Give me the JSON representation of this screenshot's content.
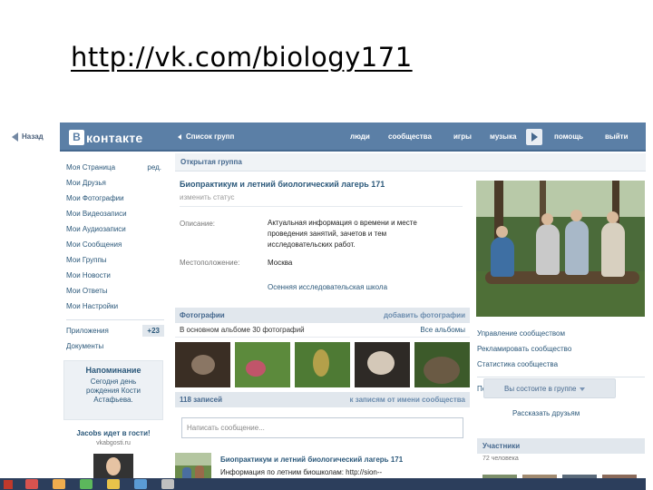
{
  "slide": {
    "title": "http://vk.com/biology171"
  },
  "back": {
    "label": "Назад"
  },
  "header": {
    "logo_letter": "В",
    "logo_text": "контакте",
    "group_list": "Список групп",
    "nav": [
      "люди",
      "сообщества",
      "игры",
      "музыка",
      "помощь",
      "выйти"
    ]
  },
  "sidebar": {
    "items": [
      {
        "label": "Моя Страница",
        "aux": "ред."
      },
      {
        "label": "Мои Друзья"
      },
      {
        "label": "Мои Фотографии"
      },
      {
        "label": "Мои Видеозаписи"
      },
      {
        "label": "Мои Аудиозаписи"
      },
      {
        "label": "Мои Сообщения"
      },
      {
        "label": "Мои Группы"
      },
      {
        "label": "Мои Новости"
      },
      {
        "label": "Мои Ответы"
      },
      {
        "label": "Мои Настройки"
      }
    ],
    "apps": {
      "label": "Приложения",
      "badge": "+23"
    },
    "docs": {
      "label": "Документы"
    }
  },
  "reminder": {
    "title": "Напоминание",
    "text": "Сегодня день рождения Кости Астафьева."
  },
  "ad": {
    "title": "Jacobs идет в гости!",
    "domain": "vkabgosti.ru"
  },
  "group": {
    "section": "Открытая группа",
    "name": "Биопрактикум и летний биологический лагерь 171",
    "status": "изменить статус",
    "description_label": "Описание:",
    "description": "Актуальная информация о времени и месте проведения занятий, зачетов и тем исследовательских работ.",
    "location_label": "Местоположение:",
    "location": "Москва",
    "school": "Осенняя исследовательская школа"
  },
  "photos": {
    "title": "Фотографии",
    "add": "добавить фотографии",
    "album": "В основном альбоме 30 фотографий",
    "all": "Все альбомы"
  },
  "wall": {
    "count": "118 записей",
    "to_records": "к записям от имени сообщества",
    "placeholder": "Написать сообщение...",
    "post": {
      "author": "Биопрактикум и летний биологический лагерь 171",
      "text": "Информация по летним биошколам: http://sion--"
    }
  },
  "manage": [
    "Управление сообществом",
    "Рекламировать сообщество",
    "Статистика сообщества"
  ],
  "translate": "Перевести в страницу",
  "membership": {
    "button": "Вы состоите в группе",
    "tell": "Рассказать друзьям"
  },
  "members": {
    "title": "Участники",
    "count": "72 человека"
  },
  "colors": {
    "header": "#5b7fa6",
    "link": "#2b587a"
  }
}
